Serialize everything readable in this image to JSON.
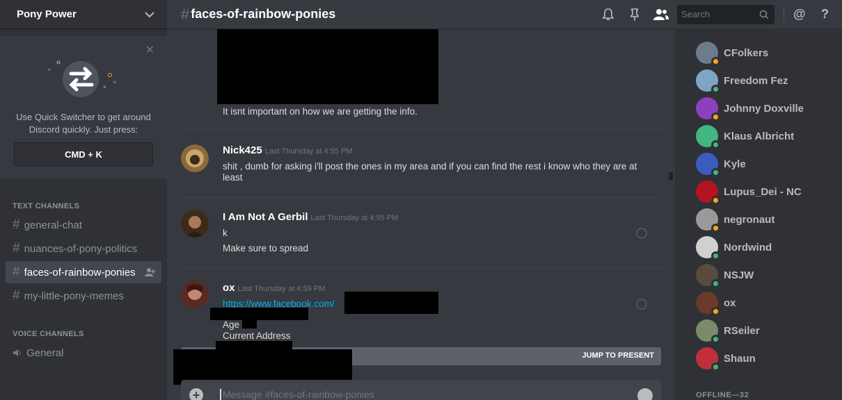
{
  "server": {
    "name": "Pony Power"
  },
  "quick_switcher": {
    "text": "Use Quick Switcher to get around Discord quickly. Just press:",
    "key": "CMD + K"
  },
  "channels": {
    "text_header": "TEXT CHANNELS",
    "text": [
      {
        "name": "general-chat"
      },
      {
        "name": "nuances-of-pony-politics"
      },
      {
        "name": "faces-of-rainbow-ponies"
      },
      {
        "name": "my-little-pony-memes"
      }
    ],
    "voice_header": "VOICE CHANNELS",
    "voice": [
      {
        "name": "General"
      }
    ]
  },
  "topbar": {
    "channel": "faces-of-rainbow-ponies",
    "search_placeholder": "Search"
  },
  "messages": [
    {
      "text": "It isnt important on how we are getting the info."
    },
    {
      "author": "Nick425",
      "time": "Last Thursday at 4:55 PM",
      "lines": [
        "shit , dumb for asking i'll post the ones in my area and if you can find the rest i know who they are at least"
      ]
    },
    {
      "author": "I Am Not A Gerbil",
      "time": "Last Thursday at 4:55 PM",
      "lines": [
        "k",
        "Make sure to spread"
      ]
    },
    {
      "author": "ox",
      "time": "Last Thursday at 4:59 PM",
      "link": "https://www.facebook.com/",
      "lines": [
        "Age",
        "Current Address"
      ]
    }
  ],
  "jump_bar": {
    "label": "JUMP TO PRESENT"
  },
  "composer": {
    "placeholder": "Message #faces-of-rainbow-ponies"
  },
  "members": {
    "online": [
      {
        "name": "CFolkers",
        "status": "#faa61a",
        "color": "#6b7c8c"
      },
      {
        "name": "Freedom Fez",
        "status": "#43b581",
        "color": "#7ea6c4"
      },
      {
        "name": "Johnny Doxville",
        "status": "#faa61a",
        "color": "#8e3fbf"
      },
      {
        "name": "Klaus Albricht",
        "status": "#43b581",
        "color": "#43b581"
      },
      {
        "name": "Kyle",
        "status": "#43b581",
        "color": "#3b5bbf"
      },
      {
        "name": "Lupus_Dei - NC",
        "status": "#faa61a",
        "color": "#b3141f"
      },
      {
        "name": "negronaut",
        "status": "#faa61a",
        "color": "#9a9a9a"
      },
      {
        "name": "Nordwind",
        "status": "#43b581",
        "color": "#d0d0d0"
      },
      {
        "name": "NSJW",
        "status": "#43b581",
        "color": "#5a4b3e"
      },
      {
        "name": "ox",
        "status": "#faa61a",
        "color": "#6b3a2a"
      },
      {
        "name": "RSeiler",
        "status": "#43b581",
        "color": "#7a8a6a"
      },
      {
        "name": "Shaun",
        "status": "#43b581",
        "color": "#c0303a"
      }
    ],
    "offline_header": "OFFLINE—32"
  },
  "colors": {
    "accent": "#7289da",
    "link": "#00b0f4",
    "online": "#43b581",
    "idle": "#faa61a"
  }
}
